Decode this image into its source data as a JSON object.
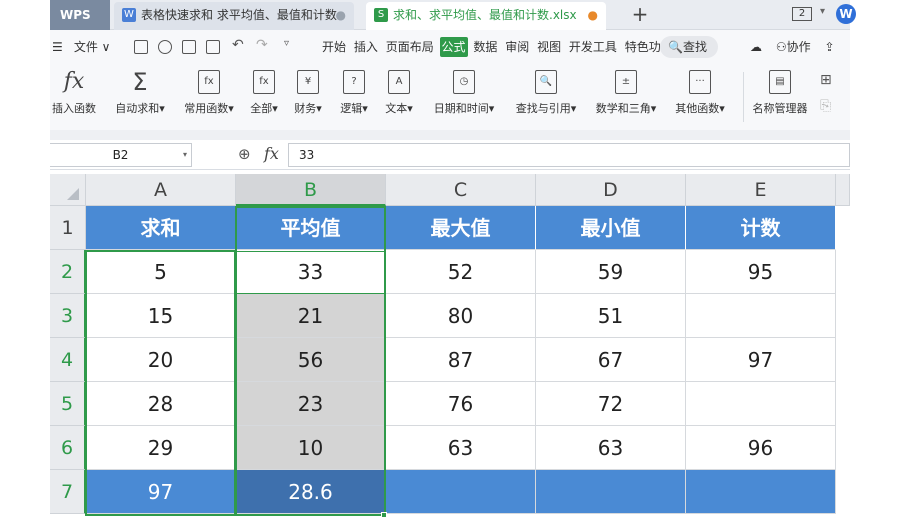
{
  "titlebar": {
    "app_logo": "WPS",
    "tabs": [
      {
        "label": "表格快速求和 求平均值、最值和计数",
        "icon": "W",
        "active": false
      },
      {
        "label": "求和、求平均值、最值和计数.xlsx",
        "icon": "S",
        "active": true
      }
    ],
    "window_count": "2",
    "account_logo": "W"
  },
  "menubar": {
    "hamburger": "☰",
    "file": "文件",
    "tabs": [
      "开始",
      "插入",
      "页面布局",
      "公式",
      "数据",
      "审阅",
      "视图",
      "开发工具",
      "特色功能"
    ],
    "active_tab": "公式",
    "search": "查找",
    "collab": "协作"
  },
  "ribbon": {
    "items": [
      {
        "label": "插入函数",
        "icon": "fx"
      },
      {
        "label": "自动求和",
        "icon": "Σ"
      },
      {
        "label": "常用函数",
        "icon": "fx"
      },
      {
        "label": "全部",
        "icon": "fx"
      },
      {
        "label": "财务",
        "icon": "¥"
      },
      {
        "label": "逻辑",
        "icon": "?"
      },
      {
        "label": "文本",
        "icon": "A"
      },
      {
        "label": "日期和时间",
        "icon": "◷"
      },
      {
        "label": "查找与引用",
        "icon": "🔍"
      },
      {
        "label": "数学和三角",
        "icon": "±"
      },
      {
        "label": "其他函数",
        "icon": "···"
      },
      {
        "label": "名称管理器",
        "icon": "▤"
      }
    ]
  },
  "formula_bar": {
    "name_box": "B2",
    "value": "33"
  },
  "sheet": {
    "columns": [
      "A",
      "B",
      "C",
      "D",
      "E"
    ],
    "rows": [
      "1",
      "2",
      "3",
      "4",
      "5",
      "6",
      "7"
    ],
    "header_row": [
      "求和",
      "平均值",
      "最大值",
      "最小值",
      "计数"
    ],
    "data": [
      [
        "5",
        "33",
        "52",
        "59",
        "95"
      ],
      [
        "15",
        "21",
        "80",
        "51",
        ""
      ],
      [
        "20",
        "56",
        "87",
        "67",
        "97"
      ],
      [
        "28",
        "23",
        "76",
        "72",
        ""
      ],
      [
        "29",
        "10",
        "63",
        "63",
        "96"
      ]
    ],
    "total_row": [
      "97",
      "28.6",
      "",
      "",
      ""
    ],
    "selected_column": "B",
    "active_cell": "B2"
  },
  "colors": {
    "header_blue": "#4a8ad4",
    "selection_green": "#2f9a4a",
    "selected_fill": "#d4d4d4"
  }
}
